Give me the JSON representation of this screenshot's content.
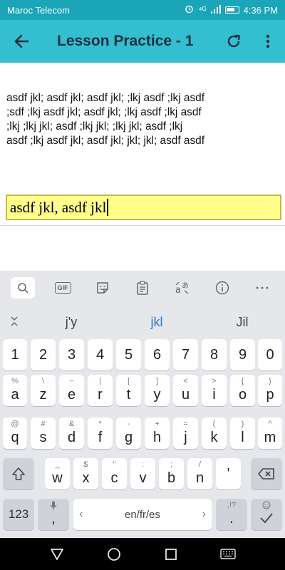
{
  "status_bar": {
    "carrier": "Maroc Telecom",
    "signal": "⁴ᴳ",
    "time": "4:36 PM"
  },
  "app_bar": {
    "title": "Lesson Practice - 1"
  },
  "lesson": {
    "lines": [
      "asdf jkl; asdf jkl; asdf jkl; ;lkj asdf ;lkj asdf",
      ";sdf ;lkj asdf jkl; asdf jkl; ;lkj asdf ;lkj asdf",
      ";lkj ;lkj jkl; asdf ;lkj jkl; ;lkj jkl; asdf ;lkj",
      "asdf ;lkj asdf jkl; asdf jkl; jkl; jkl; asdf asdf"
    ]
  },
  "input": {
    "value": "asdf jkl, asdf jkl"
  },
  "keyboard": {
    "toolbar": [
      "search-icon",
      "gif-icon",
      "sticker-icon",
      "clipboard-icon",
      "translate-icon",
      "info-icon",
      "more-icon"
    ],
    "toolbar_gif_label": "GIF",
    "suggestions": [
      "j'y",
      "jkl",
      "Jil"
    ],
    "number_row": [
      "1",
      "2",
      "3",
      "4",
      "5",
      "6",
      "7",
      "8",
      "9",
      "0"
    ],
    "row1": [
      {
        "main": "a",
        "sub": "%"
      },
      {
        "main": "z",
        "sub": "\\"
      },
      {
        "main": "e",
        "sub": "~"
      },
      {
        "main": "r",
        "sub": "|"
      },
      {
        "main": "t",
        "sub": "["
      },
      {
        "main": "y",
        "sub": "]"
      },
      {
        "main": "u",
        "sub": "<"
      },
      {
        "main": "i",
        "sub": ">"
      },
      {
        "main": "o",
        "sub": "{"
      },
      {
        "main": "p",
        "sub": "}"
      }
    ],
    "row2": [
      {
        "main": "q",
        "sub": "@"
      },
      {
        "main": "s",
        "sub": "#"
      },
      {
        "main": "d",
        "sub": "&"
      },
      {
        "main": "f",
        "sub": "*"
      },
      {
        "main": "g",
        "sub": "-"
      },
      {
        "main": "h",
        "sub": "+"
      },
      {
        "main": "j",
        "sub": "="
      },
      {
        "main": "k",
        "sub": "("
      },
      {
        "main": "l",
        "sub": ")"
      },
      {
        "main": "m",
        "sub": "^"
      }
    ],
    "row3": [
      {
        "main": "w",
        "sub": "_"
      },
      {
        "main": "x",
        "sub": "$"
      },
      {
        "main": "c",
        "sub": "\""
      },
      {
        "main": "v",
        "sub": ":"
      },
      {
        "main": "b",
        "sub": ";"
      },
      {
        "main": "n",
        "sub": "/"
      },
      {
        "main": "'",
        "sub": ""
      }
    ],
    "numbers_key": "123",
    "comma_key": ",",
    "space_label": "en/fr/es",
    "period_key": ".",
    "period_sub": ",!?"
  },
  "colors": {
    "status_bar": "#1aa5b9",
    "app_bar": "#33bfd0",
    "input_bg": "#ffff8a",
    "suggestion_highlight": "#2a77c9"
  }
}
